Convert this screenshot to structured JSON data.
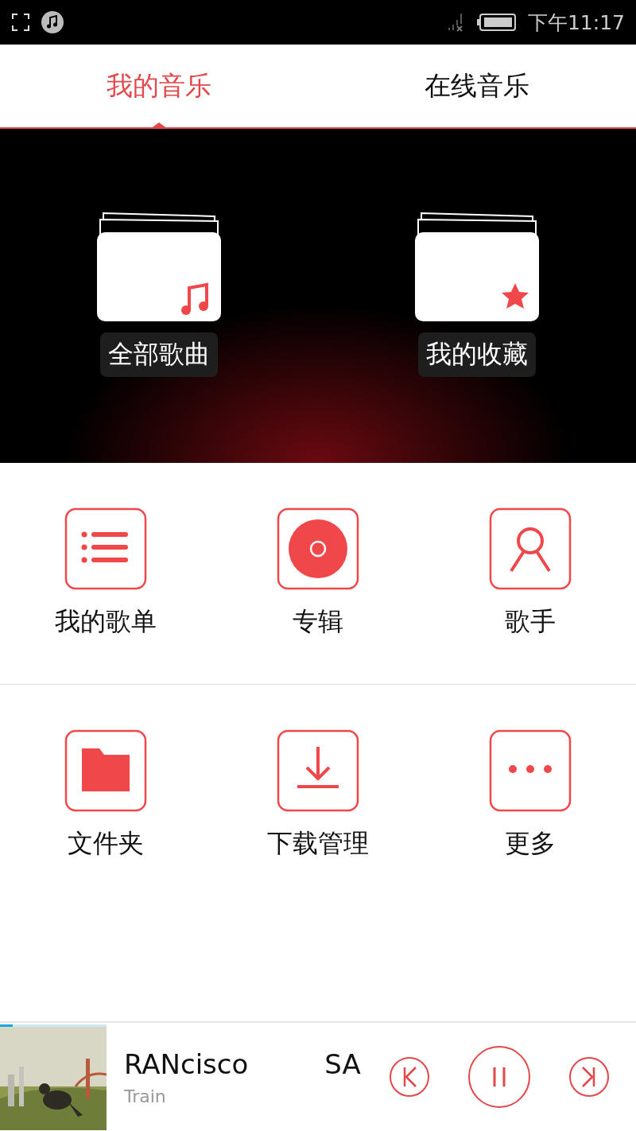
{
  "status_bar": {
    "time": "下午11:17"
  },
  "tabs": [
    {
      "label": "我的音乐",
      "selected": true
    },
    {
      "label": "在线音乐",
      "selected": false
    }
  ],
  "folders": [
    {
      "kind": "music",
      "label": "全部歌曲"
    },
    {
      "kind": "star",
      "label": "我的收藏"
    }
  ],
  "grid": [
    {
      "kind": "list",
      "label": "我的歌单"
    },
    {
      "kind": "disc",
      "label": "专辑"
    },
    {
      "kind": "singer",
      "label": "歌手"
    },
    {
      "kind": "folder",
      "label": "文件夹"
    },
    {
      "kind": "download",
      "label": "下载管理"
    },
    {
      "kind": "more",
      "label": "更多"
    }
  ],
  "player": {
    "level": 0.12,
    "title_parts": [
      "RANcisco",
      "SA"
    ],
    "artist": "Train",
    "playing": true
  }
}
